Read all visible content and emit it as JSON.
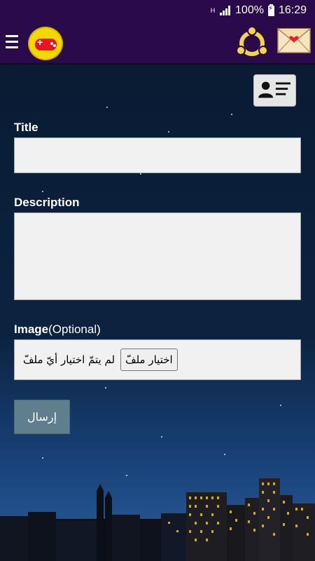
{
  "status_bar": {
    "network_type": "H",
    "battery": "100%",
    "time": "16:29",
    "icons": [
      "hplus-icon",
      "signal-icon",
      "battery-charging-icon"
    ]
  },
  "app_bar": {
    "icons": [
      "menu-icon",
      "game-controller-icon",
      "share-icon",
      "envelope-heart-icon"
    ]
  },
  "form": {
    "title_label": "Title",
    "description_label": "Description",
    "image_label": "Image",
    "image_optional": "(Optional)",
    "title_value": "",
    "description_value": "",
    "file_button_label": "اختيار ملفّ",
    "file_status": "لم يتمّ اختيار أيّ ملفّ",
    "submit_label": "إرسال"
  },
  "colors": {
    "app_bar": "#2a0a4a",
    "submit_button": "#5f7f8e",
    "game_icon": "#f5d800",
    "share_icon": "#f2d44a"
  }
}
